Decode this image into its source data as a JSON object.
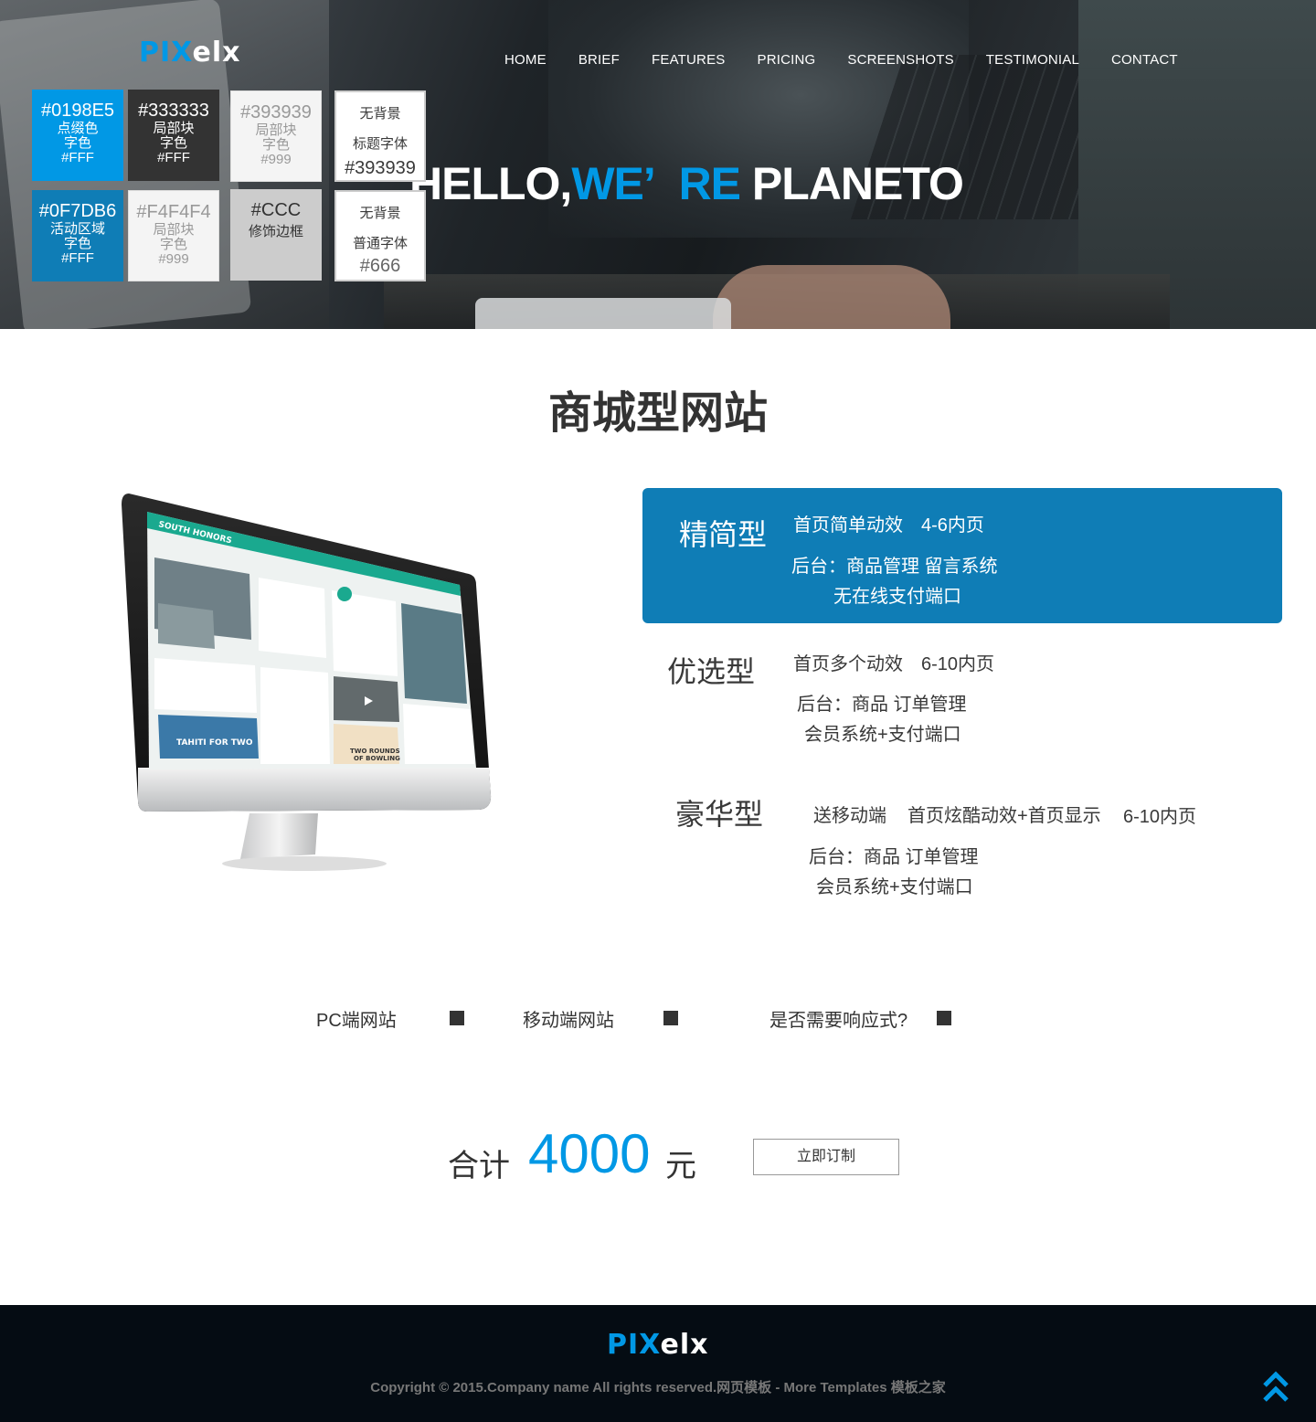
{
  "header": {
    "logo_blue": "PIX",
    "logo_rest": "elx",
    "nav": [
      "HOME",
      "BRIEF",
      "FEATURES",
      "PRICING",
      "SCREENSHOTS",
      "TESTIMONIAL",
      "CONTACT"
    ],
    "hero_title_1": "HELLO,",
    "hero_title_accent_1": "WE’",
    "hero_title_accent_2": "RE",
    "hero_title_2": " PLANETO"
  },
  "swatches": [
    {
      "code": "#0198E5",
      "lines": [
        "点缀色",
        "字色",
        "#FFF"
      ]
    },
    {
      "code": "#333333",
      "lines": [
        "局部块",
        "字色",
        "#FFF"
      ]
    },
    {
      "code": "#393939",
      "lines": [
        "局部块",
        "字色",
        "#999"
      ]
    },
    {
      "lines": [
        "无背景",
        "标题字体",
        "#393939"
      ]
    },
    {
      "code": "#0F7DB6",
      "lines": [
        "活动区域",
        "字色",
        "#FFF"
      ]
    },
    {
      "code": "#F4F4F4",
      "lines": [
        "局部块",
        "字色",
        "#999"
      ]
    },
    {
      "code": "#CCC",
      "lines": [
        "修饰边框"
      ]
    },
    {
      "lines": [
        "无背景",
        "普通字体",
        "#666"
      ]
    }
  ],
  "main": {
    "section_title": "商城型网站",
    "plans": [
      {
        "name": "精简型",
        "lines": [
          "首页简单动效　4-6内页",
          "后台：商品管理  留言系统",
          "无在线支付端口"
        ]
      },
      {
        "name": "优选型",
        "lines": [
          "首页多个动效　6-10内页",
          "后台：商品 订单管理",
          "会员系统+支付端口"
        ]
      },
      {
        "name": "豪华型",
        "lines": [
          "送移动端",
          "首页炫酷动效+首页显示",
          "6-10内页",
          "后台：商品 订单管理",
          "会员系统+支付端口"
        ]
      }
    ],
    "options": [
      "PC端网站",
      "移动端网站",
      "是否需要响应式?"
    ],
    "total_label": "合计",
    "total_amount": "4000",
    "total_unit": "元",
    "order_button": "立即订制"
  },
  "footer": {
    "logo_blue": "PIX",
    "logo_rest": "elx",
    "copyright": "Copyright © 2015.Company name All rights reserved.网页模板 - More Templates 模板之家"
  },
  "colors": {
    "accent": "#0198E5",
    "active": "#0F7DB6",
    "text": "#393939",
    "footer_bg": "#050c13"
  },
  "icons": {
    "back_to_top": "double-chevron-up-icon"
  }
}
